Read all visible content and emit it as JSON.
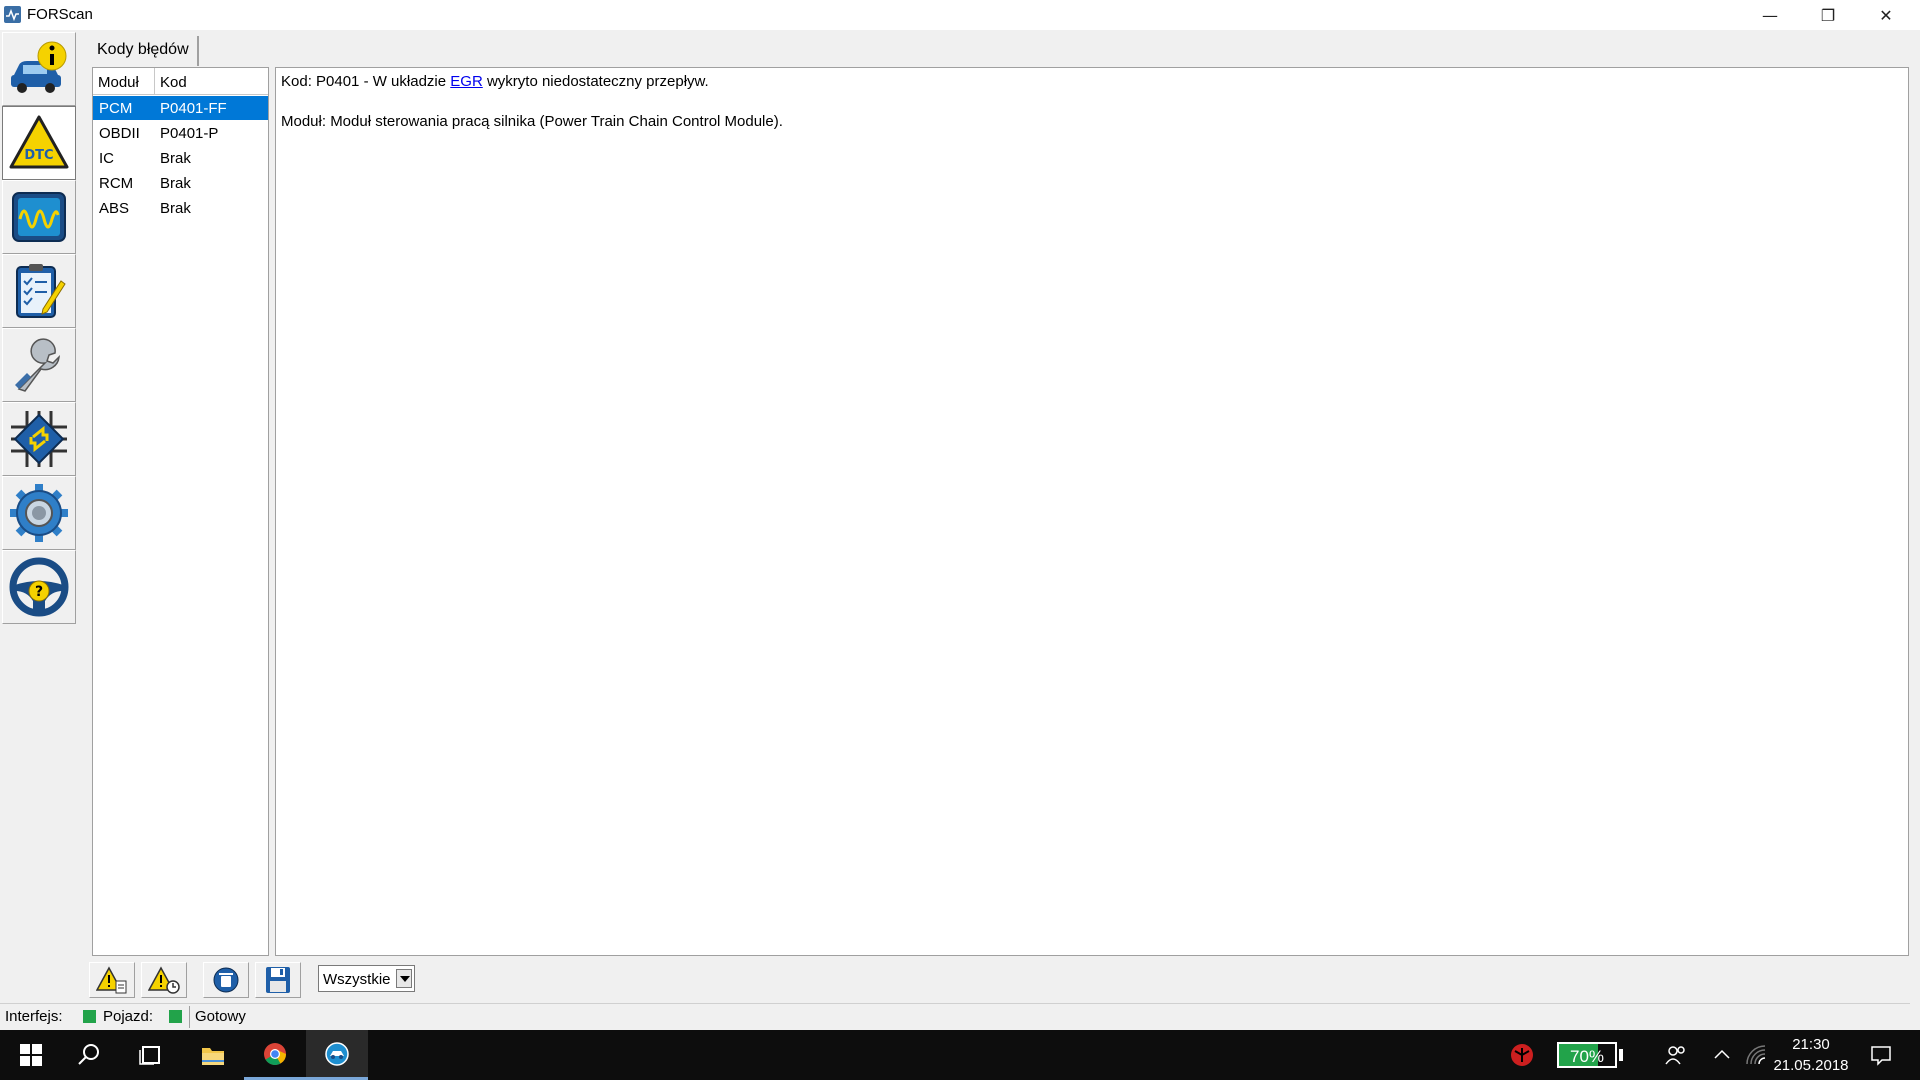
{
  "window": {
    "title": "FORScan",
    "controls": {
      "minimize": "—",
      "maximize": "❐",
      "close": "✕"
    }
  },
  "leftnav": {
    "items": [
      {
        "icon": "vehicle-info-icon",
        "active": false
      },
      {
        "icon": "dtc-warning-icon",
        "label": "DTC",
        "active": true
      },
      {
        "icon": "oscilloscope-icon",
        "active": false
      },
      {
        "icon": "checklist-icon",
        "active": false
      },
      {
        "icon": "wrench-icon",
        "active": false
      },
      {
        "icon": "module-chip-icon",
        "active": false
      },
      {
        "icon": "settings-gear-icon",
        "active": false
      },
      {
        "icon": "help-steering-wheel-icon",
        "active": false
      }
    ]
  },
  "tab": {
    "label": "Kody błędów"
  },
  "dtc_list": {
    "columns": [
      "Moduł",
      "Kod"
    ],
    "rows": [
      {
        "module": "PCM",
        "code": "P0401-FF",
        "selected": true
      },
      {
        "module": "OBDII",
        "code": "P0401-P",
        "selected": false
      },
      {
        "module": "IC",
        "code": "Brak",
        "selected": false
      },
      {
        "module": "RCM",
        "code": "Brak",
        "selected": false
      },
      {
        "module": "ABS",
        "code": "Brak",
        "selected": false
      }
    ]
  },
  "detail": {
    "line1_prefix": "Kod: P0401 - W układzie ",
    "line1_link": "EGR",
    "line1_suffix": " wykryto niedostateczny przepływ.",
    "line2": "Moduł: Moduł sterowania pracą silnika (Power Train Chain Control Module)."
  },
  "toolbar": {
    "filter_value": "Wszystkie"
  },
  "statusbar": {
    "interface_label": "Interfejs:",
    "vehicle_label": "Pojazd:",
    "status_text": "Gotowy",
    "led_color": "#22a34a"
  },
  "taskbar": {
    "battery_percent": "70%",
    "battery_level": 0.7,
    "time": "21:30",
    "date": "21.05.2018"
  }
}
